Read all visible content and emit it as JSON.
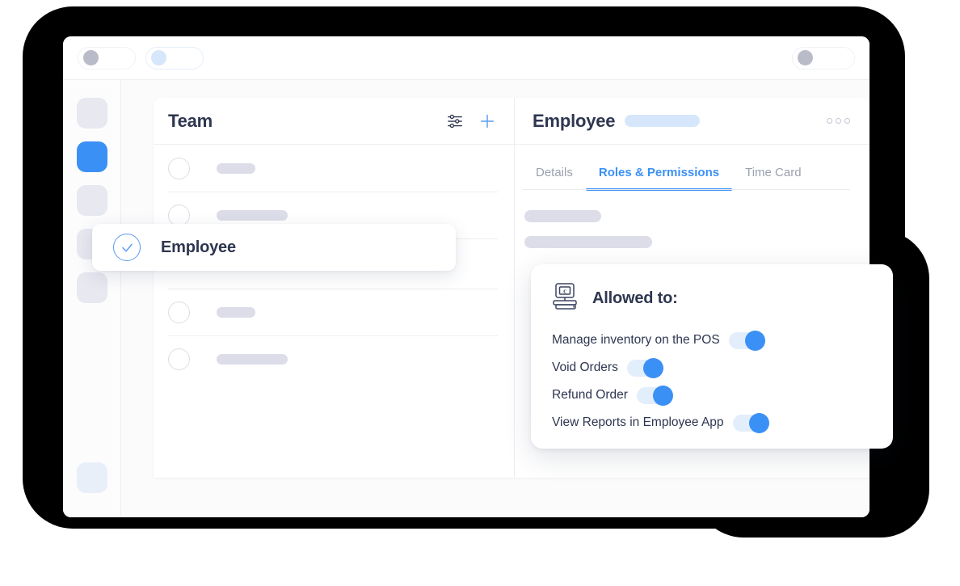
{
  "browser": {
    "tabs": [
      {
        "name": "tab-placeholder-1",
        "state": "inactive"
      },
      {
        "name": "tab-placeholder-2",
        "state": "active"
      }
    ],
    "right_control": {
      "name": "account-placeholder"
    }
  },
  "sidebar": {
    "items": [
      {
        "name": "nav-item-1",
        "active": false
      },
      {
        "name": "nav-item-2",
        "active": true
      },
      {
        "name": "nav-item-3",
        "active": false
      },
      {
        "name": "nav-item-4",
        "active": false
      },
      {
        "name": "nav-item-5",
        "active": false
      }
    ],
    "bottom_item": {
      "name": "nav-item-settings",
      "active": false
    }
  },
  "team_panel": {
    "title": "Team",
    "filter_icon": "sliders-icon",
    "add_icon": "plus-icon",
    "rows": [
      {
        "skeleton_width": 48
      },
      {
        "skeleton_width": 88
      },
      {
        "skeleton_width": 48
      },
      {
        "skeleton_width": 88
      }
    ],
    "selected_row": {
      "label": "Employee",
      "icon": "check-circle-icon",
      "selected": true
    }
  },
  "detail_panel": {
    "title": "Employee",
    "badge": {
      "name": "role-badge-placeholder"
    },
    "overflow_icon": "more-options-icon",
    "tabs": [
      {
        "label": "Details",
        "active": false
      },
      {
        "label": "Roles & Permissions",
        "active": true
      },
      {
        "label": "Time Card",
        "active": false
      }
    ],
    "skeletons": [
      {
        "width": 95
      },
      {
        "width": 158
      }
    ]
  },
  "allowed_card": {
    "icon": "pos-terminal-icon",
    "title": "Allowed to:",
    "permissions": [
      {
        "label": "Manage inventory on the POS",
        "enabled": true
      },
      {
        "label": "Void Orders",
        "enabled": true
      },
      {
        "label": "Refund Order",
        "enabled": true
      },
      {
        "label": "View Reports in Employee App",
        "enabled": true
      }
    ]
  },
  "colors": {
    "accent": "#3b90f5",
    "accent_soft": "#d6e7fb",
    "text_dark": "#2e3650",
    "text_muted": "#9ba1ae",
    "skeleton": "#dcdde9",
    "backdrop": "#000000"
  }
}
